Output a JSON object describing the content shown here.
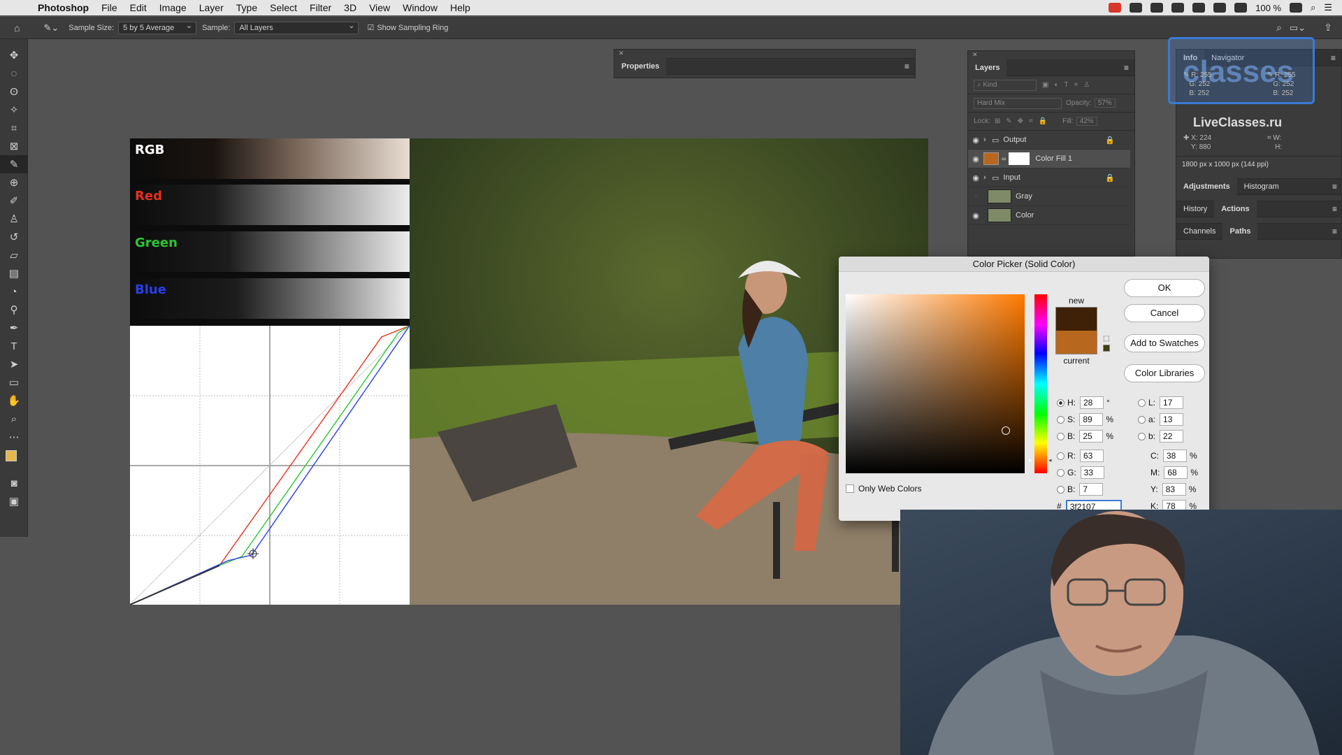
{
  "menubar": {
    "app": "Photoshop",
    "items": [
      "File",
      "Edit",
      "Image",
      "Layer",
      "Type",
      "Select",
      "Filter",
      "3D",
      "View",
      "Window",
      "Help"
    ],
    "battery": "100 %"
  },
  "options": {
    "sample_size_label": "Sample Size:",
    "sample_size_value": "5 by 5 Average",
    "sample_label": "Sample:",
    "sample_value": "All Layers",
    "sampling_ring": "Show Sampling Ring"
  },
  "doc": {
    "rows": [
      {
        "label": "RGB",
        "color": "#ffffff"
      },
      {
        "label": "Red",
        "color": "#e8301e"
      },
      {
        "label": "Green",
        "color": "#2ec436"
      },
      {
        "label": "Blue",
        "color": "#2a3ee8"
      }
    ]
  },
  "properties": {
    "title": "Properties"
  },
  "layers": {
    "title": "Layers",
    "kind": "Kind",
    "blend": "Hard Mix",
    "opacity_label": "Opacity:",
    "opacity_value": "57%",
    "lock_label": "Lock:",
    "fill_label": "Fill:",
    "fill_value": "42%",
    "items": [
      {
        "name": "Output",
        "type": "group",
        "locked": true
      },
      {
        "name": "Color Fill 1",
        "type": "fill",
        "selected": true
      },
      {
        "name": "Input",
        "type": "group",
        "locked": true
      },
      {
        "name": "Gray",
        "type": "image",
        "hidden": true
      },
      {
        "name": "Color",
        "type": "image"
      }
    ]
  },
  "info": {
    "tabs": [
      "Info",
      "Navigator"
    ],
    "r1": "255",
    "g1": "252",
    "b1": "252",
    "r2": "255",
    "g2": "252",
    "b2": "252",
    "x": "224",
    "y": "880",
    "doc_size": "1800 px x 1000 px (144 ppi)",
    "watermark": "LiveClasses.ru",
    "watermark_logo": "classes"
  },
  "side_panels": {
    "row1": [
      "Adjustments",
      "Histogram"
    ],
    "row2": [
      "History",
      "Actions"
    ],
    "row3": [
      "Channels",
      "Paths"
    ]
  },
  "picker": {
    "title": "Color Picker (Solid Color)",
    "ok": "OK",
    "cancel": "Cancel",
    "add_swatches": "Add to Swatches",
    "libraries": "Color Libraries",
    "new_label": "new",
    "current_label": "current",
    "new_color": "#3f2107",
    "current_color": "#b8671e",
    "only_web": "Only Web Colors",
    "H": "28",
    "S": "89",
    "B": "25",
    "R": "63",
    "G": "33",
    "Bv": "7",
    "L": "17",
    "a": "13",
    "b": "22",
    "C": "38",
    "M": "68",
    "Y": "83",
    "K": "78",
    "hex": "3f2107"
  }
}
